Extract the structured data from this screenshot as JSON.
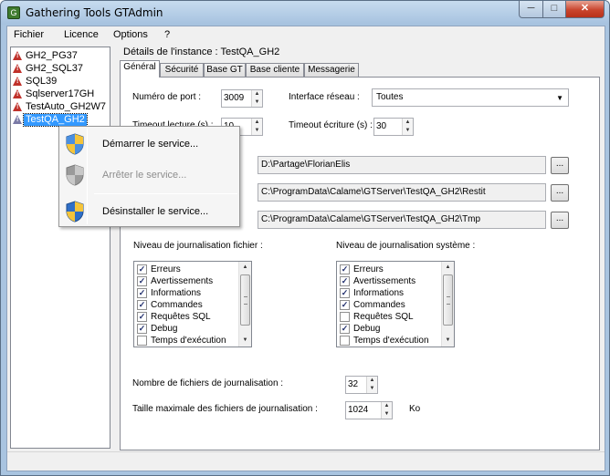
{
  "window": {
    "title": "Gathering Tools GTAdmin",
    "icon": "app-icon",
    "min_glyph": "─",
    "max_glyph": "□",
    "close_glyph": "✕"
  },
  "menubar": {
    "items": [
      "Fichier",
      "Licence",
      "Options",
      "?"
    ]
  },
  "tree": {
    "items": [
      {
        "label": "GH2_PG37",
        "icon": "warning-icon"
      },
      {
        "label": "GH2_SQL37",
        "icon": "warning-icon"
      },
      {
        "label": "SQL39",
        "icon": "warning-icon"
      },
      {
        "label": "Sqlserver17GH",
        "icon": "warning-icon"
      },
      {
        "label": "TestAuto_GH2W7",
        "icon": "warning-icon"
      },
      {
        "label": "TestQA_GH2",
        "icon": "warning-icon",
        "selected": true
      }
    ]
  },
  "details": {
    "title": "Détails de l'instance : TestQA_GH2",
    "tabs": [
      "Général",
      "Sécurité",
      "Base GT",
      "Base cliente",
      "Messagerie"
    ],
    "general": {
      "port_label": "Numéro de port :",
      "port_value": "3009",
      "timeout_read_label": "Timeout lecture (s) :",
      "timeout_read_value": "10",
      "network_label": "Interface réseau :",
      "network_value": "Toutes",
      "timeout_write_label": "Timeout écriture (s) :",
      "timeout_write_value": "30",
      "paths": [
        "D:\\Partage\\FlorianElis",
        "C:\\ProgramData\\Calame\\GTServer\\TestQA_GH2\\Restit",
        "C:\\ProgramData\\Calame\\GTServer\\TestQA_GH2\\Tmp"
      ],
      "browse_label": "...",
      "file_log_label": "Niveau de journalisation fichier :",
      "system_log_label": "Niveau de journalisation système :",
      "file_log_items": [
        {
          "label": "Erreurs",
          "checked": true
        },
        {
          "label": "Avertissements",
          "checked": true
        },
        {
          "label": "Informations",
          "checked": true
        },
        {
          "label": "Commandes",
          "checked": true
        },
        {
          "label": "Requêtes SQL",
          "checked": true
        },
        {
          "label": "Debug",
          "checked": true
        },
        {
          "label": "Temps d'exécution",
          "checked": false
        }
      ],
      "system_log_items": [
        {
          "label": "Erreurs",
          "checked": true
        },
        {
          "label": "Avertissements",
          "checked": true
        },
        {
          "label": "Informations",
          "checked": true
        },
        {
          "label": "Commandes",
          "checked": true
        },
        {
          "label": "Requêtes SQL",
          "checked": false
        },
        {
          "label": "Debug",
          "checked": true
        },
        {
          "label": "Temps d'exécution",
          "checked": false
        }
      ],
      "log_count_label": "Nombre de fichiers de journalisation :",
      "log_count_value": "32",
      "log_size_label": "Taille maximale des fichiers de journalisation :",
      "log_size_value": "1024",
      "log_size_unit": "Ko"
    }
  },
  "context_menu": {
    "items": [
      {
        "label": "Démarrer le service...",
        "icon": "uac-shield-icon",
        "enabled": true
      },
      {
        "label": "Arrêter le service...",
        "icon": "uac-shield-icon",
        "enabled": false
      },
      {
        "label": "Désinstaller le service...",
        "icon": "uac-shield-icon",
        "enabled": true
      }
    ]
  },
  "colors": {
    "selection": "#3399ff",
    "title_gradient_top": "#c7dcef",
    "close_button": "#c9452d"
  }
}
